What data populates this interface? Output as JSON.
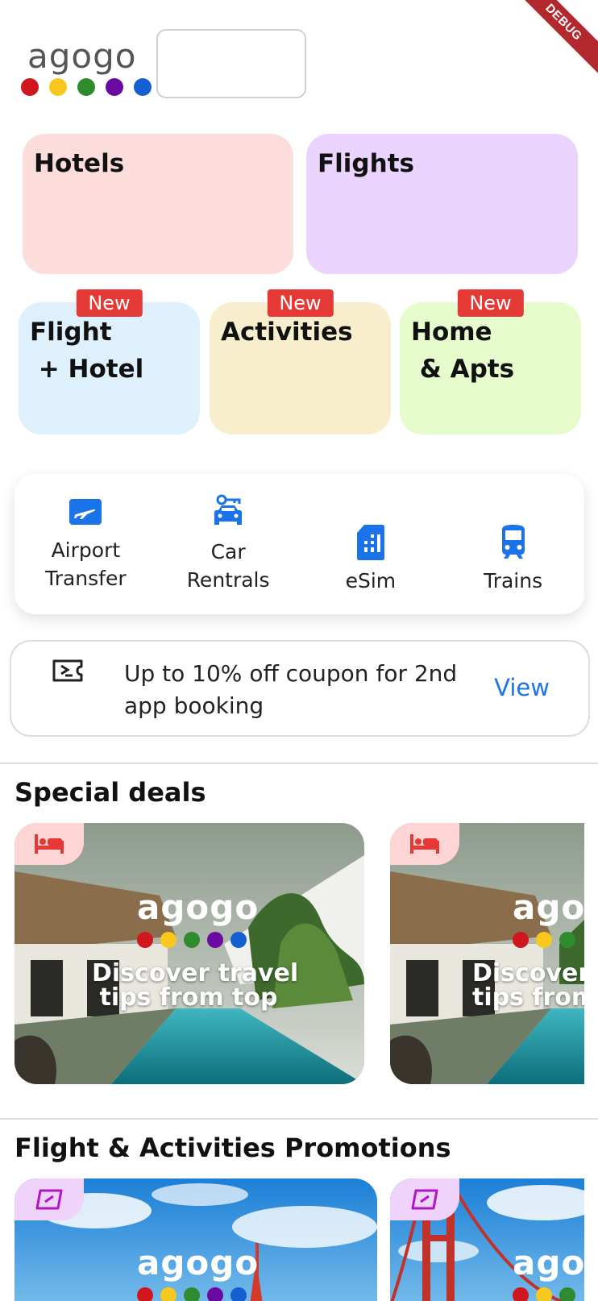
{
  "debug_banner": "DEBUG",
  "logo": {
    "text": "agogo",
    "dot_colors": [
      "#d0161e",
      "#f8c81e",
      "#2e8b2e",
      "#6a0aa0",
      "#1560d0"
    ]
  },
  "main_tiles": [
    {
      "label": "Hotels",
      "bg": "#fddcdc"
    },
    {
      "label": "Flights",
      "bg": "#ead3fd"
    }
  ],
  "secondary_tiles": [
    {
      "label": "Flight\n + Hotel",
      "badge": "New",
      "bg": "#dff0fd"
    },
    {
      "label": "Activities",
      "badge": "New",
      "bg": "#f8eecd"
    },
    {
      "label": "Home\n & Apts",
      "badge": "New",
      "bg": "#e6fccc"
    }
  ],
  "services": [
    {
      "label": "Airport\nTransfer",
      "icon": "airport-transfer-icon"
    },
    {
      "label": "Car\nRentrals",
      "icon": "car-key-icon"
    },
    {
      "label": "eSim",
      "icon": "sim-card-icon"
    },
    {
      "label": "Trains",
      "icon": "train-icon"
    }
  ],
  "coupon": {
    "icon": "ticket-icon",
    "text": "Up to 10% off coupon for 2nd app booking",
    "action": "View"
  },
  "sections": {
    "special_deals": {
      "title": "Special deals",
      "card_logo": "agogo",
      "caption": "Discover travel\ntips from top",
      "caption_cut": "Discover\ntips from",
      "logo_cut": "agogo",
      "tag_icon": "bed-icon"
    },
    "promotions": {
      "title": "Flight & Activities Promotions",
      "card_logo": "agogo",
      "logo_cut": "agogo",
      "tag_icon": "ticket-tag-icon"
    }
  },
  "colors": {
    "accent": "#1a73e8",
    "badge": "#e53935",
    "hotel_tag": "#fdd5d5",
    "promo_tag": "#efd3fb"
  }
}
